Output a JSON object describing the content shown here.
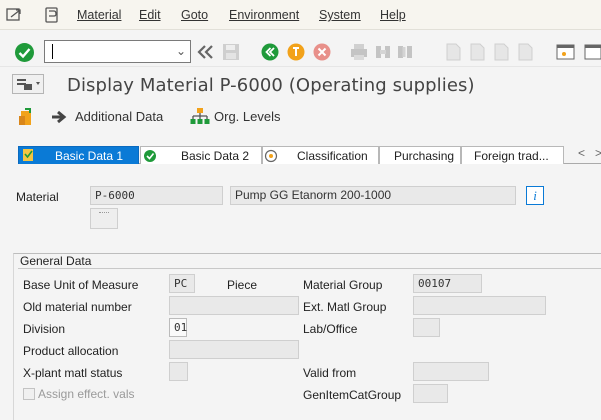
{
  "menu": {
    "items": [
      "Material",
      "Edit",
      "Goto",
      "Environment",
      "System",
      "Help"
    ]
  },
  "toolbar": {
    "command_value": ""
  },
  "title": "Display Material P-6000 (Operating supplies)",
  "app_toolbar": {
    "additional_data": "Additional Data",
    "org_levels": "Org. Levels"
  },
  "tabs": [
    {
      "label": "Basic Data 1",
      "active": true
    },
    {
      "label": "Basic Data 2",
      "active": false
    },
    {
      "label": "Classification",
      "active": false
    },
    {
      "label": "Purchasing",
      "active": false
    },
    {
      "label": "Foreign trad...",
      "active": false
    }
  ],
  "tab_nav": {
    "left": "<",
    "right": ">"
  },
  "header": {
    "material_label": "Material",
    "material_value": "P-6000",
    "material_desc": "Pump GG  Etanorm 200-1000"
  },
  "general_data": {
    "title": "General Data",
    "base_uom_label": "Base Unit of Measure",
    "base_uom_value": "PC",
    "base_uom_text": "Piece",
    "old_material_label": "Old material number",
    "old_material_value": "",
    "division_label": "Division",
    "division_value": "01",
    "product_allocation_label": "Product allocation",
    "product_allocation_value": "",
    "xplant_label": "X-plant matl status",
    "xplant_value": "",
    "assign_label": "Assign effect. vals",
    "material_group_label": "Material Group",
    "material_group_value": "00107",
    "ext_matl_group_label": "Ext. Matl Group",
    "ext_matl_group_value": "",
    "lab_office_label": "Lab/Office",
    "lab_office_value": "",
    "valid_from_label": "Valid from",
    "valid_from_value": "",
    "genitem_label": "GenItemCatGroup",
    "genitem_value": ""
  },
  "colors": {
    "accent": "#0a7ad6",
    "green": "#1f9a3a",
    "orange": "#f2a21a",
    "red": "#e2453d"
  }
}
